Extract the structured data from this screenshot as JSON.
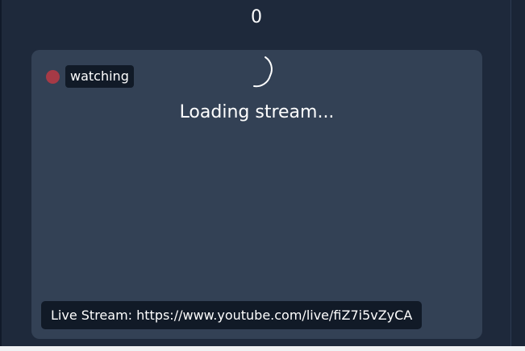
{
  "counter": {
    "value": "0"
  },
  "stream": {
    "status_badge": "watching",
    "loading_text": "Loading stream...",
    "url_label": "Live Stream: https://www.youtube.com/live/fiZ7i5vZyCA"
  },
  "icons": {
    "live_indicator": "live-dot-icon",
    "spinner": "loading-spinner-icon"
  },
  "colors": {
    "page_background": "#1e293b",
    "card_background": "#334155",
    "badge_background": "#111a27",
    "live_dot": "#a63a46",
    "text": "#ffffff"
  }
}
